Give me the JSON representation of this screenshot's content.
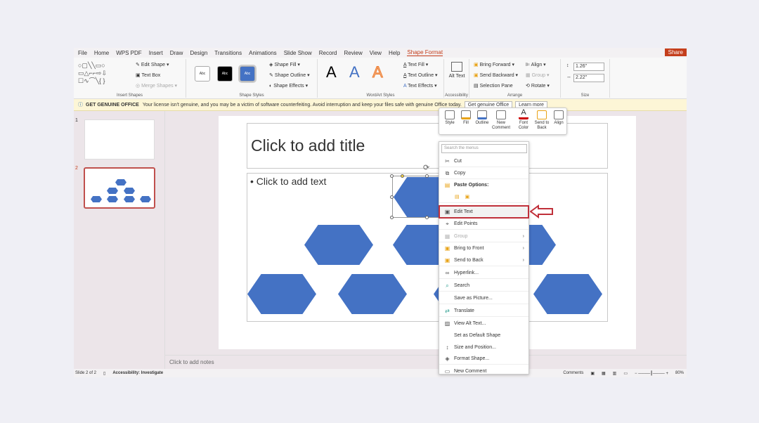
{
  "menu_tabs": [
    "File",
    "Home",
    "WPS PDF",
    "Insert",
    "Draw",
    "Design",
    "Transitions",
    "Animations",
    "Slide Show",
    "Record",
    "Review",
    "View",
    "Help",
    "Shape Format"
  ],
  "active_tab": "Shape Format",
  "share_label": "Share",
  "ribbon": {
    "insert_shapes": {
      "label": "Insert Shapes",
      "edit_shape": "Edit Shape",
      "text_box": "Text Box",
      "merge_shapes": "Merge Shapes"
    },
    "shape_styles": {
      "label": "Shape Styles",
      "swatches": [
        "Abc",
        "Abc",
        "Abc"
      ],
      "shape_fill": "Shape Fill",
      "shape_outline": "Shape Outline",
      "shape_effects": "Shape Effects"
    },
    "wordart": {
      "label": "WordArt Styles",
      "letters": [
        "A",
        "A",
        "A"
      ],
      "text_fill": "Text Fill",
      "text_outline": "Text Outline",
      "text_effects": "Text Effects"
    },
    "accessibility": {
      "label": "Accessibility",
      "alt_text": "Alt Text"
    },
    "arrange": {
      "label": "Arrange",
      "bring_forward": "Bring Forward",
      "send_backward": "Send Backward",
      "selection_pane": "Selection Pane",
      "align": "Align",
      "group": "Group",
      "rotate": "Rotate"
    },
    "size": {
      "label": "Size",
      "height": "1.26\"",
      "width": "2.22\""
    }
  },
  "notification": {
    "title": "GET GENUINE OFFICE",
    "message": "Your license isn't genuine, and you may be a victim of software counterfeiting. Avoid interruption and keep your files safe with genuine Office today.",
    "btn1": "Get genuine Office",
    "btn2": "Learn more"
  },
  "slides": [
    "1",
    "2"
  ],
  "slide": {
    "title_placeholder": "Click to add title",
    "content_placeholder": "• Click to add text"
  },
  "notes_placeholder": "Click to add notes",
  "status": {
    "slide_count": "Slide 2 of 2",
    "accessibility": "Accessibility: Investigate",
    "comments": "Comments",
    "zoom": "80%"
  },
  "mini_toolbar": [
    "Style",
    "Fill",
    "Outline",
    "New Comment",
    "Font Color",
    "Send to Back",
    "Align"
  ],
  "context_menu": {
    "search_placeholder": "Search the menus",
    "items": [
      {
        "label": "Cut",
        "icon": "scissors-icon"
      },
      {
        "label": "Copy",
        "icon": "copy-icon"
      },
      {
        "label": "Paste Options:",
        "icon": "paste-icon"
      },
      {
        "label": "",
        "icon": "paste-options-icon"
      },
      {
        "label": "Edit Text",
        "icon": "edit-text-icon"
      },
      {
        "label": "Edit Points",
        "icon": "edit-points-icon"
      },
      {
        "label": "Group",
        "icon": "group-icon"
      },
      {
        "label": "Bring to Front",
        "icon": "bring-front-icon"
      },
      {
        "label": "Send to Back",
        "icon": "send-back-icon"
      },
      {
        "label": "Hyperlink...",
        "icon": "link-icon"
      },
      {
        "label": "Search",
        "icon": "search-icon"
      },
      {
        "label": "Save as Picture...",
        "icon": ""
      },
      {
        "label": "Translate",
        "icon": "translate-icon"
      },
      {
        "label": "View Alt Text...",
        "icon": "alt-text-icon"
      },
      {
        "label": "Set as Default Shape",
        "icon": ""
      },
      {
        "label": "Size and Position...",
        "icon": "size-icon"
      },
      {
        "label": "Format Shape...",
        "icon": "format-shape-icon"
      },
      {
        "label": "New Comment",
        "icon": "comment-icon"
      }
    ]
  },
  "colors": {
    "accent": "#c43e1c",
    "shape": "#4472c4",
    "highlight": "#c0303a"
  }
}
